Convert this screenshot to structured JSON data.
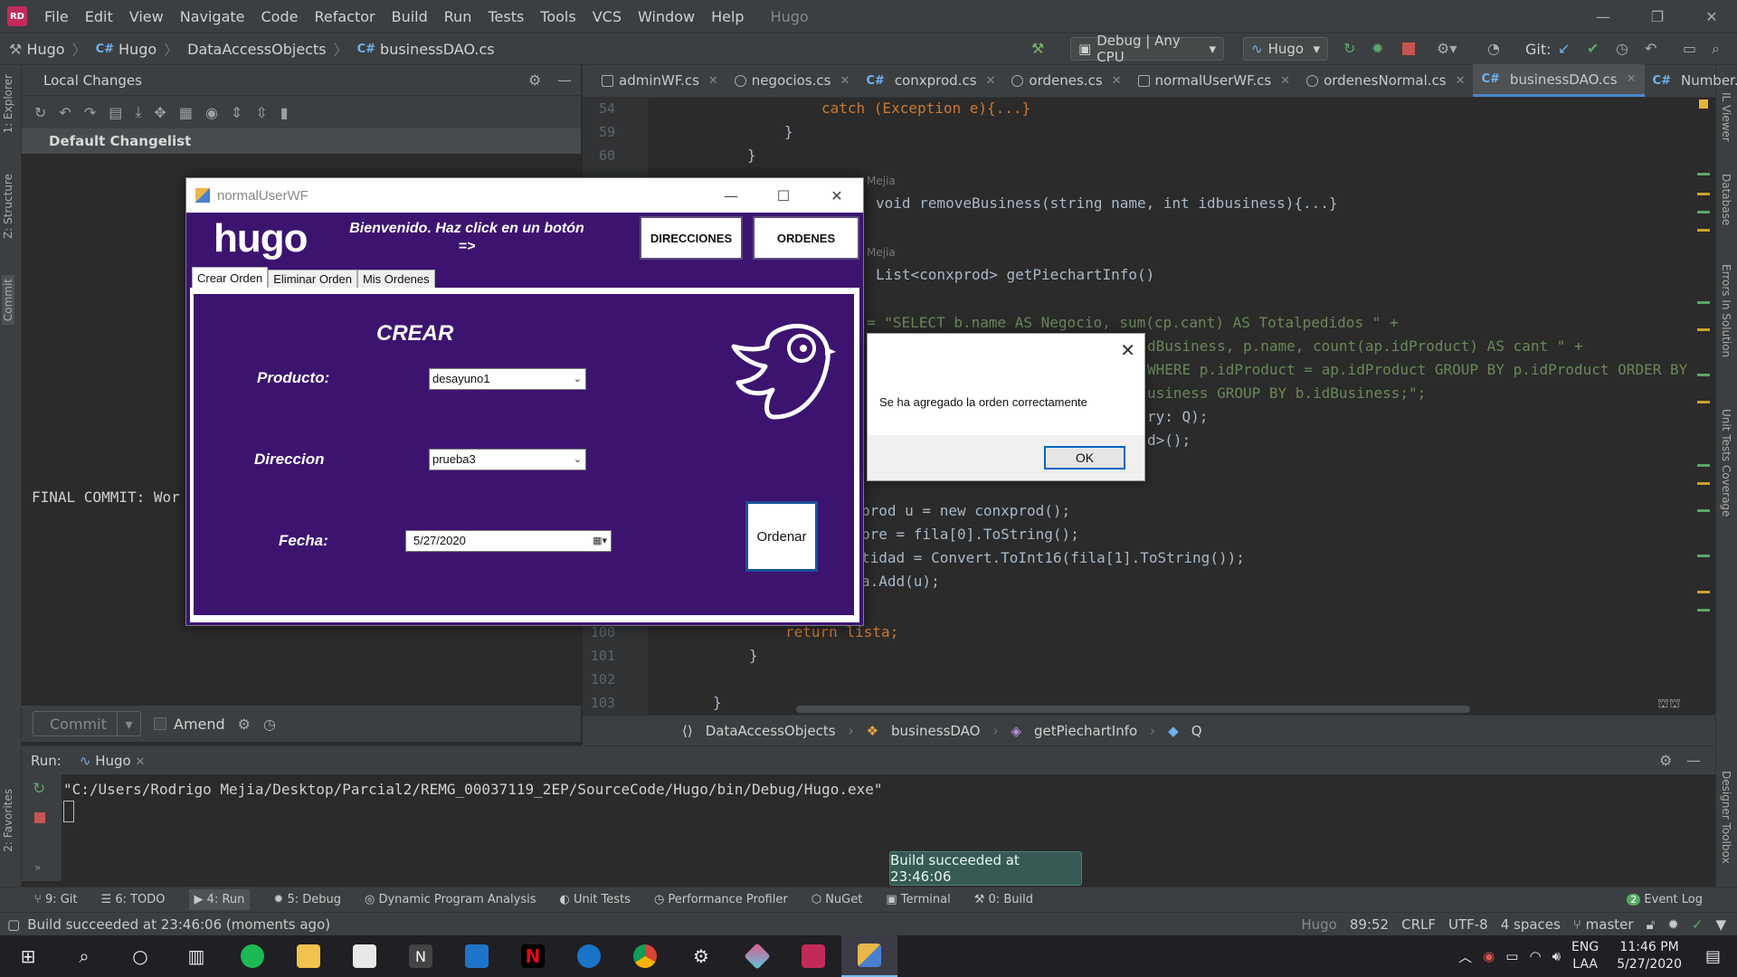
{
  "menubar": {
    "items": [
      "File",
      "Edit",
      "View",
      "Navigate",
      "Code",
      "Refactor",
      "Build",
      "Run",
      "Tests",
      "Tools",
      "VCS",
      "Window",
      "Help"
    ],
    "app_title": "Hugo",
    "logo": "RD"
  },
  "navbar": {
    "crumbs": [
      "Hugo",
      "Hugo",
      "DataAccessObjects",
      "businessDAO.cs"
    ],
    "config": "Debug | Any CPU",
    "run_target": "Hugo",
    "git_label": "Git:"
  },
  "left_strip": [
    "1: Explorer",
    "Z: Structure",
    "Commit",
    "2: Favorites"
  ],
  "right_strip": [
    "IL Viewer",
    "Database",
    "Errors In Solution",
    "Unit Tests Coverage",
    "Designer Toolbox"
  ],
  "local_changes": {
    "title": "Local Changes",
    "changelist": "Default Changelist",
    "final_commit_text": "FINAL COMMIT: Wor",
    "commit_label": "Commit",
    "amend_label": "Amend"
  },
  "editor_tabs": [
    {
      "label": "adminWF.cs",
      "icon": "form-icon",
      "active": false
    },
    {
      "label": "negocios.cs",
      "icon": "class-icon",
      "active": false
    },
    {
      "label": "conxprod.cs",
      "icon": "csharp-icon",
      "active": false
    },
    {
      "label": "ordenes.cs",
      "icon": "class-icon",
      "active": false
    },
    {
      "label": "normalUserWF.cs",
      "icon": "form-icon",
      "active": false
    },
    {
      "label": "ordenesNormal.cs",
      "icon": "class-icon",
      "active": false
    },
    {
      "label": "businessDAO.cs",
      "icon": "csharp-icon",
      "active": true
    },
    {
      "label": "Number.cs",
      "icon": "csharp-icon",
      "active": false
    }
  ],
  "code": {
    "line_numbers": [
      "54",
      "59",
      "60",
      "100",
      "101",
      "102",
      "103"
    ],
    "hint_author": "Mejia",
    "line_catch": "catch (Exception e){...}",
    "line_remove": "void removeBusiness(string name, int idbusiness){...}",
    "line_getpie": "List<conxprod> getPiechartInfo()",
    "line_sql1": "= \"SELECT b.name AS Negocio, sum(cp.cant) AS Totalpedidos \" +",
    "line_sql2": "dBusiness, p.name, count(ap.idProduct) AS cant \" +",
    "line_sql3": "WHERE p.idProduct = ap.idProduct GROUP BY p.idProduct ORDER BY",
    "line_sql4": "usiness GROUP BY b.idBusiness;\";",
    "line_query": "ry: Q);",
    "line_list": "d>();",
    "line_new": "prod u = new conxprod();",
    "line_nombre": "bre = fila[0].ToString();",
    "line_cantidad": "tidad = Convert.ToInt16(fila[1].ToString());",
    "line_add": "a.Add(u);",
    "line_return": "return lista;"
  },
  "editor_crumbs": [
    "DataAccessObjects",
    "businessDAO",
    "getPiechartInfo",
    "Q"
  ],
  "run_panel": {
    "label": "Run:",
    "tab": "Hugo",
    "path": "\"C:/Users/Rodrigo Mejia/Desktop/Parcial2/REMG_00037119_2EP/SourceCode/Hugo/bin/Debug/Hugo.exe\""
  },
  "toast": "Build succeeded at 23:46:06",
  "tool_tabs": [
    "9: Git",
    "6: TODO",
    "4: Run",
    "5: Debug",
    "Dynamic Program Analysis",
    "Unit Tests",
    "Performance Profiler",
    "NuGet",
    "Terminal",
    "0: Build"
  ],
  "event_log": {
    "count": "2",
    "label": "Event Log"
  },
  "status": {
    "message": "Build succeeded at 23:46:06 (moments ago)",
    "project": "Hugo",
    "position": "89:52",
    "line_sep": "CRLF",
    "encoding": "UTF-8",
    "indent": "4 spaces",
    "branch": "master"
  },
  "taskbar": {
    "lang": "ENG",
    "layout": "LAA",
    "time": "11:46 PM",
    "date": "5/27/2020"
  },
  "winform": {
    "title": "normalUserWF",
    "logo": "hugo",
    "welcome": "Bienvenido. Haz click en un botón =>",
    "btn_direcciones": "DIRECCIONES",
    "btn_ordenes": "ORDENES",
    "tabs": [
      "Crear Orden",
      "Eliminar Orden",
      "Mis Ordenes"
    ],
    "heading": "CREAR",
    "producto_label": "Producto:",
    "producto_value": "desayuno1",
    "direccion_label": "Direccion",
    "direccion_value": "prueba3",
    "fecha_label": "Fecha:",
    "fecha_value": "5/27/2020",
    "ordenar": "Ordenar"
  },
  "msgbox": {
    "text": "Se ha agregado la orden correctamente",
    "ok": "OK"
  },
  "colors": {
    "purple": "#3c1470",
    "toast": "#355b54",
    "accent": "#4a88c7"
  }
}
